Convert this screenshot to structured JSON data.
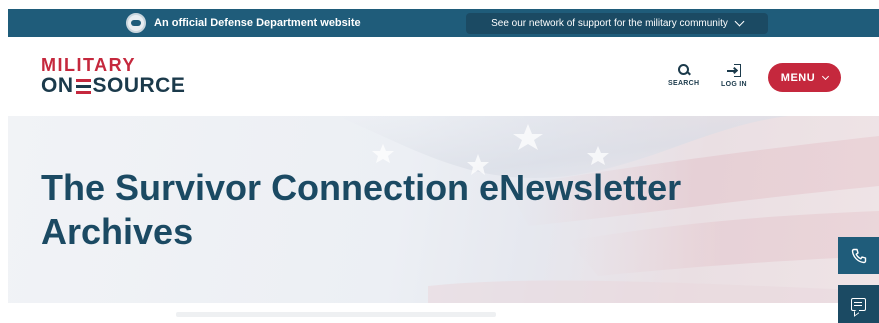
{
  "banner": {
    "official_text": "An official Defense Department website",
    "network_text": "See our network of support for the military community",
    "seal_icon": "dod-seal-icon",
    "network_icon": "chevron-down-icon"
  },
  "header": {
    "logo_top": "MILITARY",
    "logo_left": "ON",
    "logo_right": "SOURCE",
    "search_label": "SEARCH",
    "login_label": "LOG IN",
    "menu_label": "MENU",
    "search_icon": "search-icon",
    "login_icon": "login-icon"
  },
  "hero": {
    "title_line1": "The Survivor Connection eNewsletter",
    "title_line2": "Archives"
  },
  "side_tabs": {
    "phone_icon": "phone-icon",
    "chat_icon": "chat-icon"
  },
  "colors": {
    "banner_blue": "#1f5c7a",
    "brand_red": "#c5283d",
    "brand_navy": "#1b3a4b",
    "hero_title": "#1b4a63"
  }
}
